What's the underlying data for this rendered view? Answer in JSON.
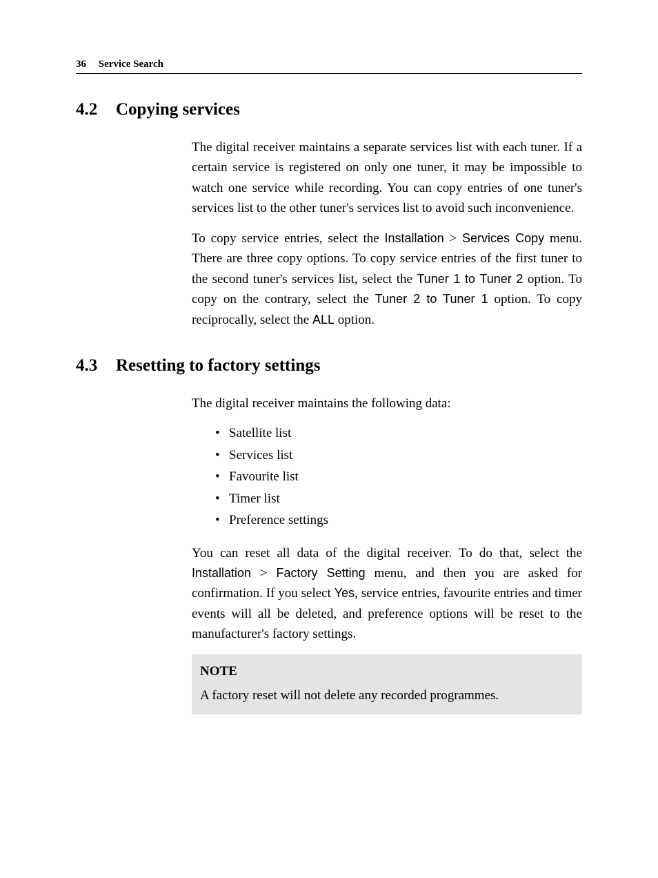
{
  "header": {
    "page_number": "36",
    "running_title": "Service Search"
  },
  "sections": [
    {
      "number": "4.2",
      "title": "Copying services",
      "paragraphs": [
        {
          "type": "plain",
          "text": "The digital receiver maintains a separate services list with each tuner. If a certain service is registered on only one tuner, it may be impossible to watch one service while recording. You can copy entries of one tuner's services list to the other tuner's services list to avoid such inconvenience."
        },
        {
          "type": "mixed",
          "parts": [
            {
              "t": "text",
              "v": "To copy service entries, select the "
            },
            {
              "t": "ui",
              "v": "Installation"
            },
            {
              "t": "gt",
              "v": " > "
            },
            {
              "t": "ui",
              "v": "Services Copy"
            },
            {
              "t": "text",
              "v": " menu. There are three copy options. To copy service entries of the first tuner to the second tuner's services list, select the "
            },
            {
              "t": "ui",
              "v": "Tuner 1 to Tuner 2"
            },
            {
              "t": "text",
              "v": " option. To copy on the contrary, select the "
            },
            {
              "t": "ui",
              "v": "Tuner 2 to Tuner 1"
            },
            {
              "t": "text",
              "v": " option. To copy reciprocally, select the "
            },
            {
              "t": "ui",
              "v": "ALL"
            },
            {
              "t": "text",
              "v": " option."
            }
          ]
        }
      ]
    },
    {
      "number": "4.3",
      "title": "Resetting to factory settings",
      "paragraphs": [
        {
          "type": "plain",
          "text": "The digital receiver maintains the following data:"
        },
        {
          "type": "list",
          "items": [
            "Satellite list",
            "Services list",
            "Favourite list",
            "Timer list",
            "Preference settings"
          ]
        },
        {
          "type": "mixed",
          "parts": [
            {
              "t": "text",
              "v": "You can reset all data of the digital receiver. To do that, select the "
            },
            {
              "t": "ui",
              "v": "Installation"
            },
            {
              "t": "gt",
              "v": " > "
            },
            {
              "t": "ui",
              "v": "Factory Setting"
            },
            {
              "t": "text",
              "v": " menu, and then you are asked for confirmation. If you select "
            },
            {
              "t": "ui",
              "v": "Yes"
            },
            {
              "t": "text",
              "v": ", service entries, favourite entries and timer events will all be deleted, and preference options will be reset to the manufacturer's factory settings."
            }
          ]
        },
        {
          "type": "note",
          "title": "NOTE",
          "text": "A factory reset will not delete any recorded programmes."
        }
      ]
    }
  ]
}
